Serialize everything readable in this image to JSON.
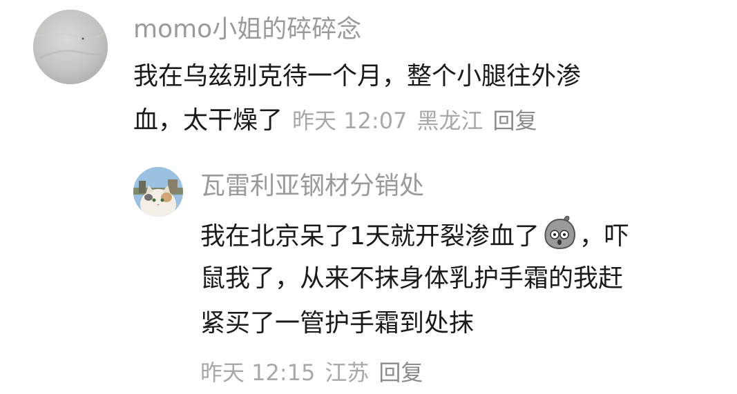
{
  "comments": [
    {
      "username": "momo小姐的碎碎念",
      "avatar_icon": "gray-texture-avatar",
      "text_line1": "我在乌兹别克待一个月，整个小腿往外渗",
      "text_line2": "血，太干燥了",
      "time": "昨天 12:07",
      "location": "黑龙江",
      "reply_label": "回复",
      "replies": [
        {
          "username": "瓦雷利亚钢材分销处",
          "avatar_icon": "cat-avatar",
          "text_line1_before_emoji": "我在北京呆了1天就开裂渗血了",
          "emoji_icon": "shocked-rock-emoji",
          "text_line1_after_emoji": "，吓",
          "text_line2": "鼠我了，从来不抹身体乳护手霜的我赶",
          "text_line3": "紧买了一管护手霜到处抹",
          "time": "昨天 12:15",
          "location": "江苏",
          "reply_label": "回复"
        }
      ]
    }
  ],
  "colors": {
    "background": "#ffffff",
    "username": "#9a9a9a",
    "body_text": "#1a1a1a",
    "meta_text": "#a8a8a8"
  }
}
